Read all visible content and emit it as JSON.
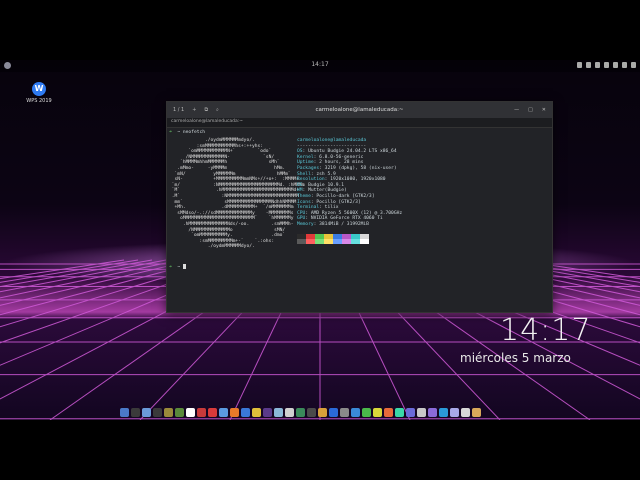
{
  "topbar": {
    "clock": "14:17"
  },
  "desktop_icon": {
    "label": "WPS 2019",
    "glyph": "W"
  },
  "window": {
    "title": "carmeloalone@lamaleducada:~",
    "tab_counter": "1 / 1",
    "tab_label": "carmeloalone@lamaleducada:~",
    "controls": [
      "—",
      "□",
      "✕"
    ]
  },
  "terminal": {
    "prompt_arrow": "➜",
    "prompt_dir": "~",
    "command": "neofetch",
    "ascii_art": [
      "             ./oydmMMMMMMmdyo/.",
      "          :smMMMMMMMMMMMhs+:++yhs:",
      "       `omMMMMMMMMMMMN+`        `odo`",
      "      /NMMMMMMMMMMMMN-            `sN/",
      "    `hMMMMmhhmMMMMMMh               sMh`",
      "   .mMmo-     -yMMMMm                 hMm.",
      "  `mN/          yMMMMMMm               hMMm`",
      "  sN-           +MMMMMMMMMMmmNMs+//+o+:  :MMMMs",
      " `m/            :NMMMMMMMMMMMMMMMMMMMMMMd. :hMMMm",
      " `M`             .hMMMMMMMMMMMMMMMMMMMMMMMMMMd+",
      " .M`               :NMMMMMMMMMMMMMMMMMMMMMMMMMM",
      "  mm`               sMMMMMMMMMMMMMMMMNdhhNMMMM",
      "  +Mh.             .dMMMMMMMMMM+  `/mMMMMMMMm",
      "   sMMdso/-.://sdMMMMMMMMMMMMMy    -MMMMMMMMs",
      "    oMMMMMMMMMMMMMMMMMMMMMMMMMM`    `hMMMMMMy",
      "     .hMMMMMMMMMMMMMMNds/-oo.        .smMMMh-",
      "       /NMMMMMMMMMMMMMo               sMN/",
      "        `omMMMMMMMMMMy.              .dmo`",
      "           :smMMMMMMMMMm+-`    `.:ohs:",
      "              ./oydmMMMMMMdyo/."
    ],
    "info_header": "carmeloalone@lamaleducada",
    "info_separator": "-------------------------",
    "info": [
      {
        "key": "OS",
        "value": "Ubuntu Budgie 24.04.2 LTS x86_64"
      },
      {
        "key": "Kernel",
        "value": "6.8.0-56-generic"
      },
      {
        "key": "Uptime",
        "value": "2 hours, 28 mins"
      },
      {
        "key": "Packages",
        "value": "3219 (dpkg), 58 (nix-user)"
      },
      {
        "key": "Shell",
        "value": "zsh 5.9"
      },
      {
        "key": "Resolution",
        "value": "1920x1080, 1920x1080"
      },
      {
        "key": "DE",
        "value": "Budgie 10.9.1"
      },
      {
        "key": "WM",
        "value": "Mutter(Budgie)"
      },
      {
        "key": "Theme",
        "value": "Pocillo-dark [GTK2/3]"
      },
      {
        "key": "Icons",
        "value": "Pocillo [GTK2/3]"
      },
      {
        "key": "Terminal",
        "value": "tilix"
      },
      {
        "key": "CPU",
        "value": "AMD Ryzen 5 5600X (12) @ 3.700GHz"
      },
      {
        "key": "GPU",
        "value": "NVIDIA GeForce RTX 4060 Ti"
      },
      {
        "key": "Memory",
        "value": "3814MiB / 31992MiB"
      }
    ],
    "swatch_colors": [
      "#2b2b2b",
      "#e03a3a",
      "#52c552",
      "#e8c43a",
      "#3a7be0",
      "#b858c8",
      "#3ac8c8",
      "#d8d8d8"
    ],
    "swatch_colors_bright": [
      "#5a5a5a",
      "#ff5f5f",
      "#7ae07a",
      "#ffe066",
      "#6aa0ff",
      "#d888e8",
      "#66e0e0",
      "#ffffff"
    ]
  },
  "lockclock": {
    "time": "14:17",
    "date": "miércoles   5 marzo"
  },
  "dock_colors": [
    "#4a7ac8",
    "#3a3a3a",
    "#6a9ad8",
    "#3a3a3a",
    "#9a8a3a",
    "#5a8a3a",
    "#ffffff",
    "#c83a3a",
    "#d83a3a",
    "#5a9ae0",
    "#e87a2a",
    "#3a78d8",
    "#e0c03a",
    "#5a3a8a",
    "#8ab8d8",
    "#d0d0d0",
    "#3a8a5a",
    "#4a4a4a",
    "#d8a03a",
    "#2a6ad8",
    "#8a8a8a",
    "#3a8ad8",
    "#4ab84a",
    "#d8d83a",
    "#e86a3a",
    "#3ad8a8",
    "#6a6ad8",
    "#c8c8c8",
    "#8a6ad8",
    "#2a9ad8",
    "#a8a8e8",
    "#d8d8d8",
    "#d8a85a"
  ]
}
